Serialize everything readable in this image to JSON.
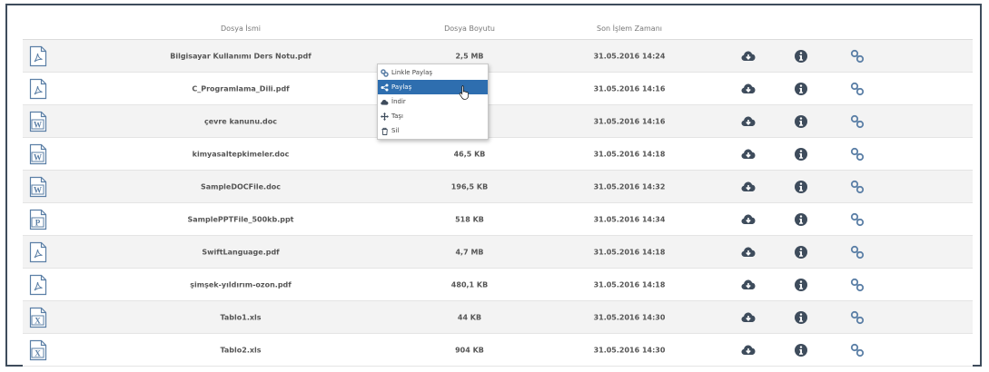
{
  "table": {
    "headers": {
      "name": "Dosya İsmi",
      "size": "Dosya Boyutu",
      "time": "Son İşlem Zamanı"
    },
    "rows": [
      {
        "name": "Bilgisayar Kullanımı Ders Notu.pdf",
        "size": "2,5 MB",
        "time": "31.05.2016 14:24",
        "type": "pdf-icon"
      },
      {
        "name": "C_Programlama_Dili.pdf",
        "size": "",
        "time": "31.05.2016 14:16",
        "type": "pdf-icon"
      },
      {
        "name": "çevre kanunu.doc",
        "size": "",
        "time": "31.05.2016 14:16",
        "type": "word-icon"
      },
      {
        "name": "kimyasaltepkimeler.doc",
        "size": "46,5 KB",
        "time": "31.05.2016 14:18",
        "type": "word-icon"
      },
      {
        "name": "SampleDOCFile.doc",
        "size": "196,5 KB",
        "time": "31.05.2016 14:32",
        "type": "word-icon"
      },
      {
        "name": "SamplePPTFile_500kb.ppt",
        "size": "518 KB",
        "time": "31.05.2016 14:34",
        "type": "powerpoint-icon"
      },
      {
        "name": "SwiftLanguage.pdf",
        "size": "4,7 MB",
        "time": "31.05.2016 14:18",
        "type": "pdf-icon"
      },
      {
        "name": "şimşek-yıldırım-ozon.pdf",
        "size": "480,1 KB",
        "time": "31.05.2016 14:18",
        "type": "pdf-icon"
      },
      {
        "name": "Tablo1.xls",
        "size": "44 KB",
        "time": "31.05.2016 14:30",
        "type": "excel-icon"
      },
      {
        "name": "Tablo2.xls",
        "size": "904 KB",
        "time": "31.05.2016 14:30",
        "type": "excel-icon"
      }
    ]
  },
  "context_menu": {
    "items": [
      {
        "label": "Linkle Paylaş",
        "icon": "link-icon"
      },
      {
        "label": "Paylaş",
        "icon": "share-icon",
        "active": true
      },
      {
        "label": "İndir",
        "icon": "cloud-download-icon"
      },
      {
        "label": "Taşı",
        "icon": "move-icon"
      },
      {
        "label": "Sil",
        "icon": "trash-icon"
      }
    ]
  },
  "colors": {
    "action_icon": "#3e4c5c",
    "file_icon": "#5b7fa6",
    "menu_active": "#2e6eaf",
    "frame_border": "#3e4c5c"
  }
}
